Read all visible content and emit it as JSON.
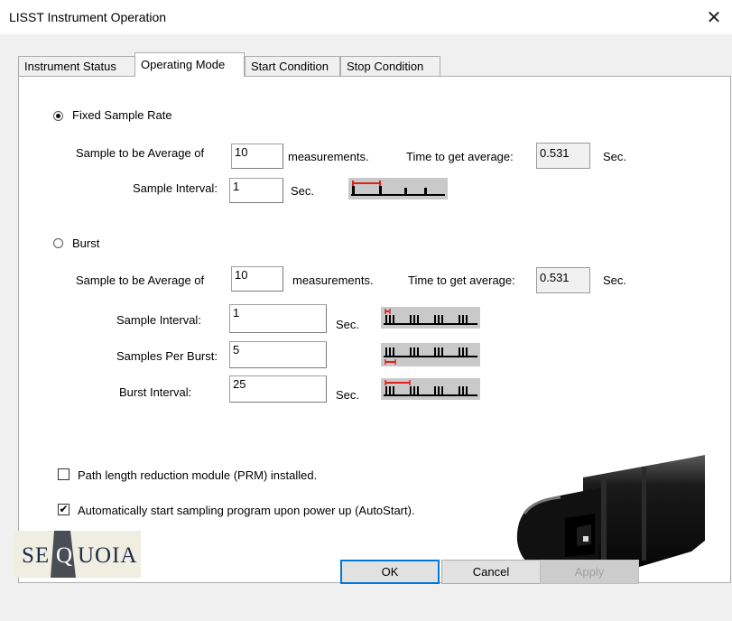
{
  "window": {
    "title": "LISST Instrument Operation"
  },
  "tabs": [
    {
      "label": "Instrument Status"
    },
    {
      "label": "Operating Mode"
    },
    {
      "label": "Start Condition"
    },
    {
      "label": "Stop Condition"
    }
  ],
  "fixed": {
    "radio_label": "Fixed Sample Rate",
    "selected": true,
    "avg_label": "Sample to be Average of",
    "avg_value": "10",
    "measurements_label": "measurements.",
    "time_label": "Time to get average:",
    "time_value": "0.531",
    "sec_label": "Sec.",
    "interval_label": "Sample Interval:",
    "interval_value": "1",
    "interval_sec_label": "Sec."
  },
  "burst": {
    "radio_label": "Burst",
    "selected": false,
    "avg_label": "Sample to be Average of",
    "avg_value": "10",
    "measurements_label": "measurements.",
    "time_label": "Time to get average:",
    "time_value": "0.531",
    "sec_label": "Sec.",
    "interval_label": "Sample Interval:",
    "interval_value": "1",
    "interval_sec_label": "Sec.",
    "per_burst_label": "Samples Per Burst:",
    "per_burst_value": "5",
    "burst_interval_label": "Burst Interval:",
    "burst_interval_value": "25",
    "burst_sec_label": "Sec."
  },
  "options": {
    "prm_label": "Path length reduction module (PRM) installed.",
    "prm_checked": false,
    "autostart_label": "Automatically start sampling program upon power up (AutoStart).",
    "autostart_checked": true
  },
  "logo": {
    "text_left": "SE",
    "text_q": "Q",
    "text_right": "UOIA"
  },
  "buttons": {
    "ok": "OK",
    "cancel": "Cancel",
    "apply": "Apply"
  },
  "colors": {
    "accent": "#0078d7",
    "marker": "#e0201c",
    "panel_bg": "#f0f0f0"
  }
}
